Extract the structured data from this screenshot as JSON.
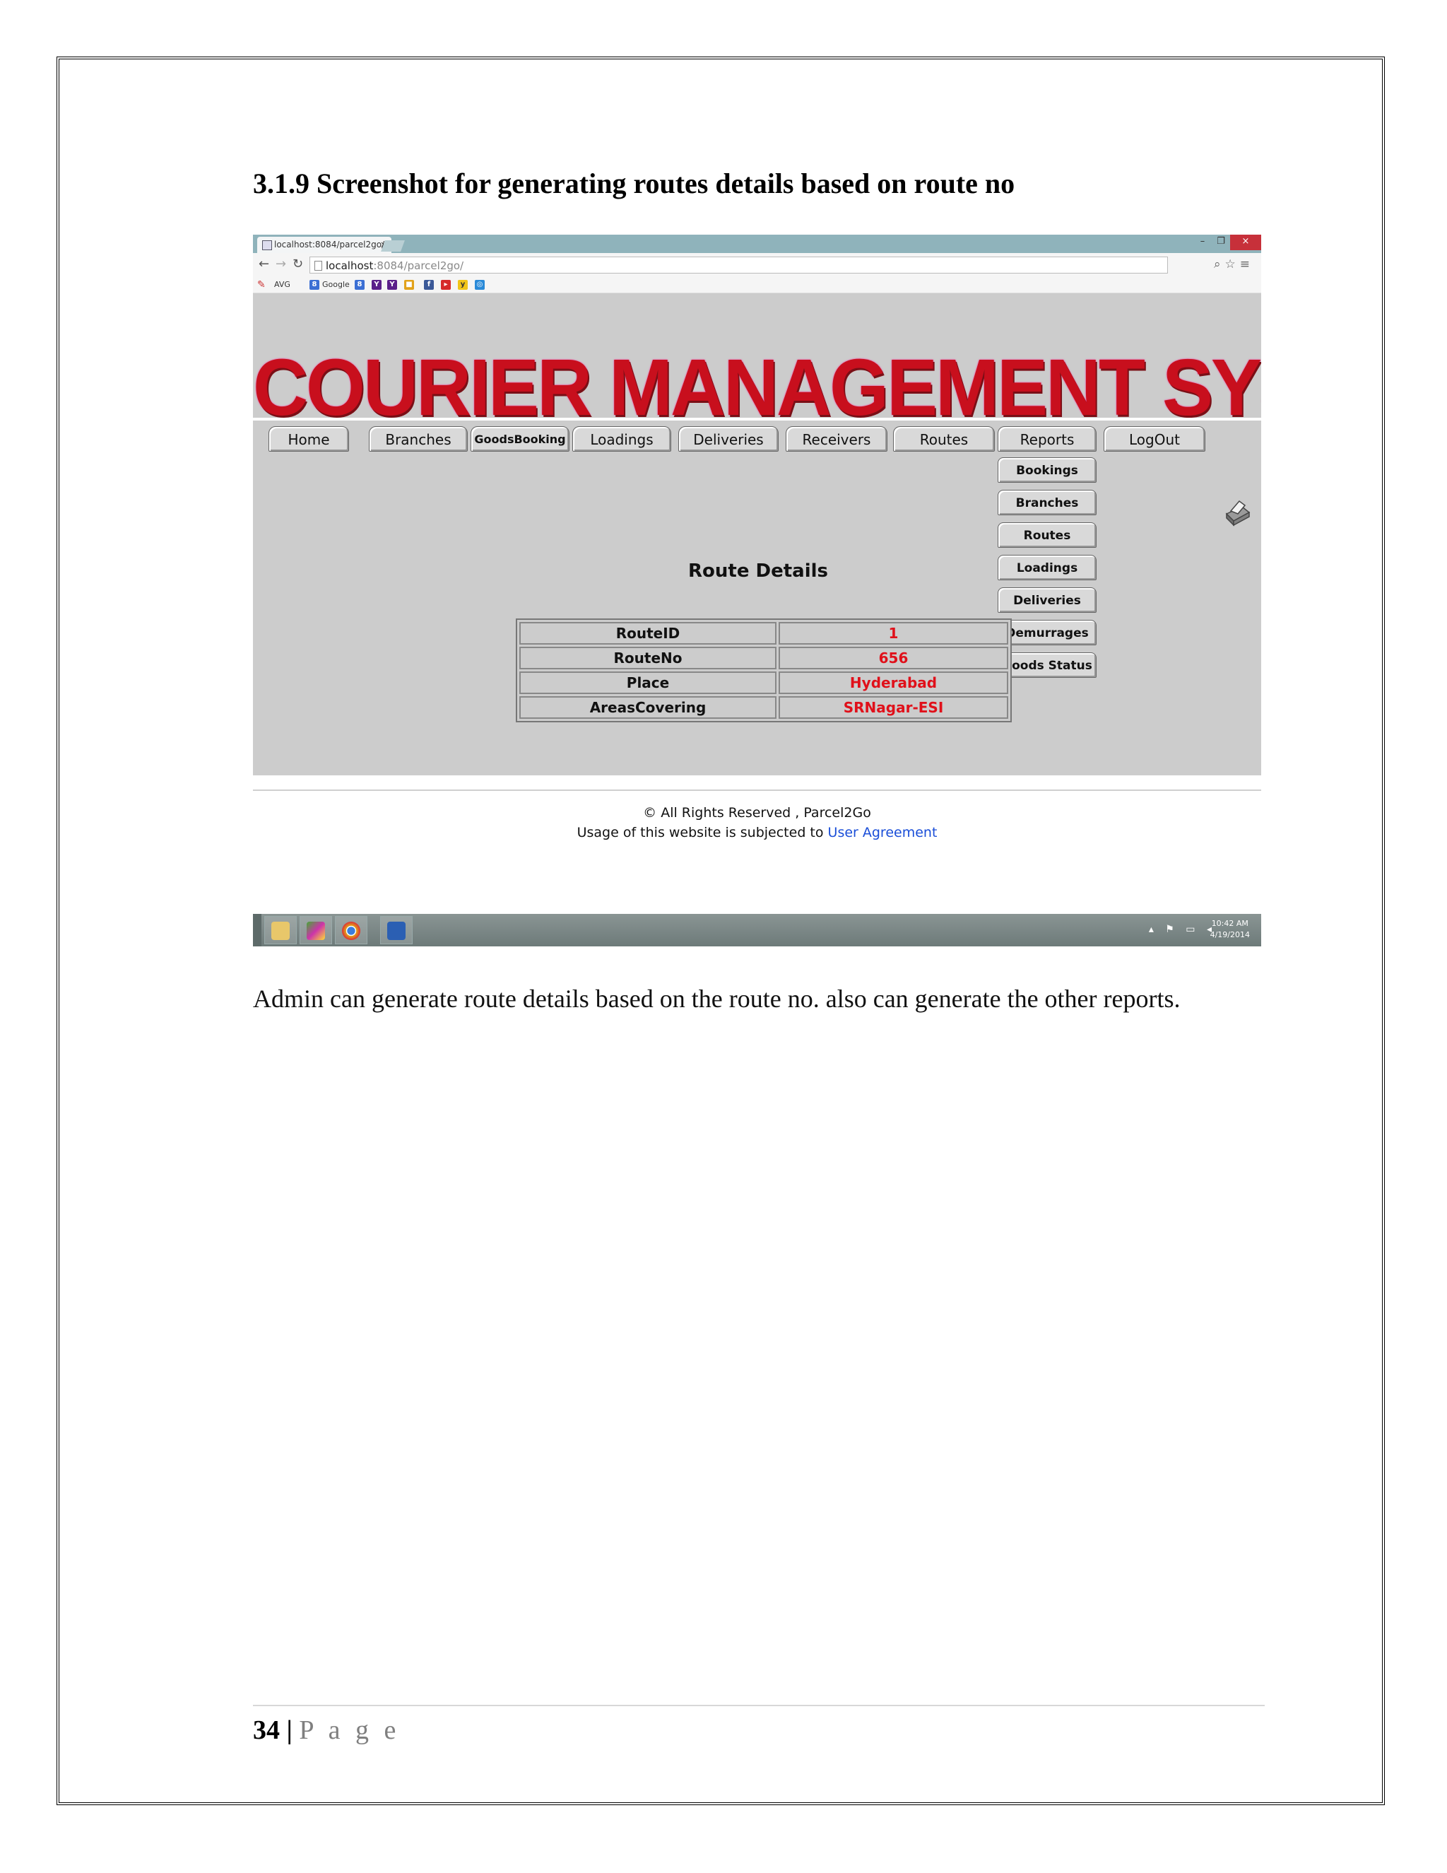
{
  "document": {
    "heading": "3.1.9 Screenshot for generating routes details based on route no",
    "caption": "Admin can generate route details based on the route no. also can generate the other reports.",
    "page_number": "34",
    "page_separator": "|",
    "page_word": "P a g e"
  },
  "browser": {
    "tab_title": "localhost:8084/parcel2go/",
    "tab_close": "×",
    "url_host": "localhost",
    "url_path": ":8084/parcel2go/",
    "window_buttons": {
      "minimize": "–",
      "restore": "❐",
      "close": "×"
    },
    "bookmarks": [
      {
        "label": "AVG"
      },
      {
        "label": "Google"
      }
    ]
  },
  "app": {
    "logo": "COURIER MANAGEMENT SYSTEM",
    "nav": [
      {
        "label": "Home"
      },
      {
        "label": "Branches"
      },
      {
        "label": "GoodsBooking"
      },
      {
        "label": "Loadings"
      },
      {
        "label": "Deliveries"
      },
      {
        "label": "Receivers"
      },
      {
        "label": "Routes"
      },
      {
        "label": "Reports"
      },
      {
        "label": "LogOut"
      }
    ],
    "reports_menu": [
      {
        "label": "Bookings"
      },
      {
        "label": "Branches"
      },
      {
        "label": "Routes"
      },
      {
        "label": "Loadings"
      },
      {
        "label": "Deliveries"
      },
      {
        "label": "Demurrages"
      },
      {
        "label": "Goods Status"
      }
    ],
    "route_title": "Route Details",
    "route_details": [
      {
        "label": "RouteID",
        "value": "1"
      },
      {
        "label": "RouteNo",
        "value": "656"
      },
      {
        "label": "Place",
        "value": "Hyderabad"
      },
      {
        "label": "AreasCovering",
        "value": "SRNagar-ESI"
      }
    ],
    "footer": {
      "copyright": "© All Rights Reserved , Parcel2Go",
      "usage_prefix": "Usage of this website is subjected to ",
      "usage_link": "User Agreement"
    }
  },
  "taskbar": {
    "time": "10:42 AM",
    "date": "4/19/2014"
  },
  "colors": {
    "logo_red": "#c80f1d",
    "value_red": "#e0101a",
    "panel_gray": "#cccccc",
    "link_blue": "#1a4ed8"
  },
  "icons": [
    "file-explorer-icon",
    "paint-icon",
    "chrome-icon",
    "word-icon",
    "printer-icon",
    "back-arrow-icon",
    "forward-arrow-icon",
    "reload-icon",
    "star-icon",
    "menu-icon"
  ]
}
